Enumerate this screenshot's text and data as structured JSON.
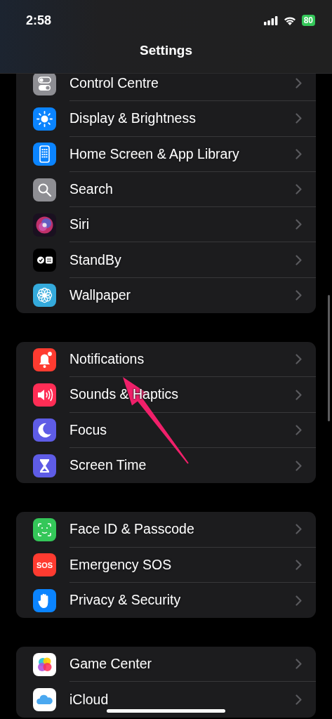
{
  "status_bar": {
    "time": "2:58",
    "battery": "80"
  },
  "title": "Settings",
  "groups": [
    {
      "rows": [
        {
          "label": "Control Centre",
          "kind": "toggles"
        },
        {
          "label": "Display & Brightness",
          "kind": "sun"
        },
        {
          "label": "Home Screen & App Library",
          "kind": "phone"
        },
        {
          "label": "Search",
          "kind": "search"
        },
        {
          "label": "Siri",
          "kind": "siri"
        },
        {
          "label": "StandBy",
          "kind": "standby"
        },
        {
          "label": "Wallpaper",
          "kind": "flower"
        }
      ]
    },
    {
      "rows": [
        {
          "label": "Notifications",
          "kind": "bell"
        },
        {
          "label": "Sounds & Haptics",
          "kind": "speaker"
        },
        {
          "label": "Focus",
          "kind": "moon"
        },
        {
          "label": "Screen Time",
          "kind": "hourglass"
        }
      ]
    },
    {
      "rows": [
        {
          "label": "Face ID & Passcode",
          "kind": "faceid"
        },
        {
          "label": "Emergency SOS",
          "kind": "sos",
          "icon_text": "SOS"
        },
        {
          "label": "Privacy & Security",
          "kind": "hand"
        }
      ]
    },
    {
      "rows": [
        {
          "label": "Game Center",
          "kind": "gamecenter"
        },
        {
          "label": "iCloud",
          "kind": "cloud"
        }
      ]
    }
  ]
}
